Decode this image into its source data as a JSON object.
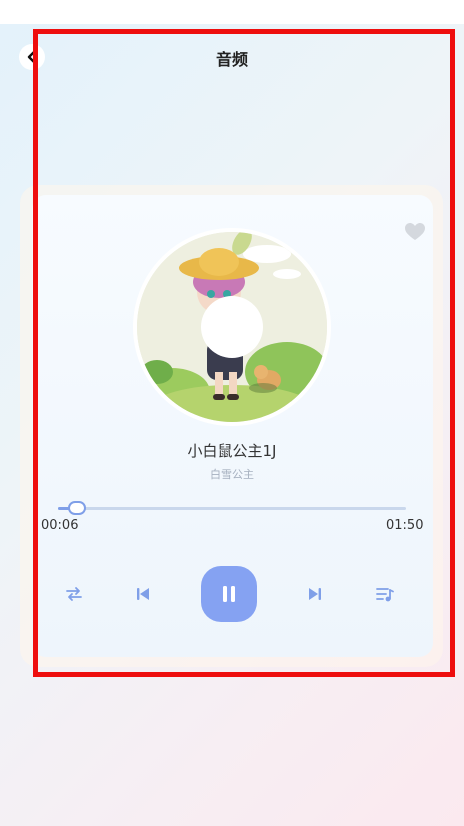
{
  "header": {
    "title": "音频",
    "back_icon": "chevron-left-icon"
  },
  "player": {
    "song_title": "小白鼠公主1J",
    "artist": "白雪公主",
    "current_time": "00:06",
    "total_time": "01:50",
    "progress_fraction": 0.055,
    "is_playing": true,
    "accent_color": "#85a2f2",
    "icons": {
      "like": "heart-icon",
      "repeat": "repeat-icon",
      "previous": "skip-previous-icon",
      "play_pause": "pause-icon",
      "next": "skip-next-icon",
      "playlist": "playlist-icon"
    }
  }
}
